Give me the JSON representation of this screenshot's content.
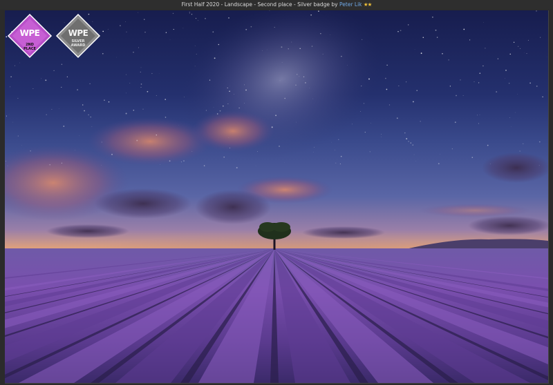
{
  "caption": {
    "prefix": "First Half 2020 - Landscape - Second place - Silver badge by",
    "photographer": "Peter Lik",
    "stars": "★★"
  },
  "badges": [
    {
      "logo": "WPE",
      "line1": "2ND",
      "line2": "PLACE",
      "color": "#b84fc8"
    },
    {
      "logo": "WPE",
      "line1": "SILVER",
      "line2": "AWARD",
      "color": "#9a9a9a"
    }
  ],
  "colors": {
    "sky_top": "#1d2358",
    "sky_mid": "#3a4a8c",
    "horizon_glow": "#e59a6a",
    "lavender": "#7a4fae",
    "caption_link": "#6fa8e6",
    "caption_stars": "#f0c23a"
  }
}
